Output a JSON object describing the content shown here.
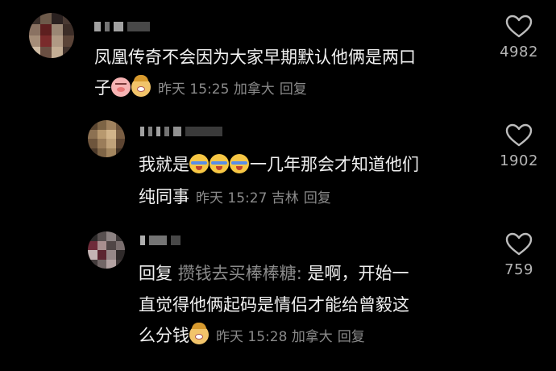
{
  "comments": [
    {
      "text_line1": "凤凰传奇不会因为大家早期默认他俩是两口",
      "text_line2": "子",
      "time": "昨天 15:25",
      "location": "加拿大",
      "reply": "回复",
      "likes": "4982",
      "emojis": [
        "pig-face-emoji",
        "dog-face-emoji"
      ]
    },
    {
      "text_prefix": "我就是",
      "text_suffix": "一几年那会才知道他们",
      "text_line2": "纯同事",
      "time": "昨天 15:27",
      "location": "吉林",
      "reply": "回复",
      "likes": "1902",
      "emojis": [
        "crying-emoji",
        "crying-emoji",
        "crying-emoji"
      ]
    },
    {
      "reply_prefix": "回复",
      "mention": "攒钱去买棒棒糖",
      "mention_sep": ":",
      "text_line1": "是啊，开始一",
      "text_line2": "直觉得他俩起码是情侣才能给曾毅这",
      "text_line3": "么分钱",
      "time": "昨天 15:28",
      "location": "加拿大",
      "reply": "回复",
      "likes": "759",
      "emojis": [
        "dog-face-emoji"
      ]
    }
  ],
  "colors": {
    "background": "#000000",
    "text": "#f0f0f0",
    "meta": "#8a8a8a",
    "likes": "#b5b5b5"
  },
  "icons": {
    "like": "heart-outline-icon"
  }
}
